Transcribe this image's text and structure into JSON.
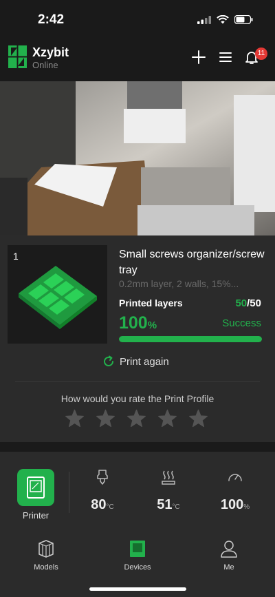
{
  "status_bar": {
    "time": "2:42"
  },
  "header": {
    "app_name": "Xzybit",
    "status": "Online",
    "notifications_count": "11",
    "icons": [
      "plus-icon",
      "menu-icon",
      "bell-icon"
    ]
  },
  "job": {
    "number": "1",
    "title": "Small screws organizer/screw tray",
    "description": "0.2mm layer, 2 walls, 15%...",
    "layers_label": "Printed layers",
    "layers_current": "50",
    "layers_total": "/50",
    "percent": "100",
    "percent_unit": "%",
    "progress_fraction": 1.0,
    "status": "Success",
    "print_again": "Print again"
  },
  "rating": {
    "title": "How would you rate the Print Profile",
    "stars": 5,
    "filled": 0
  },
  "dock": {
    "printer_label": "Printer",
    "stats": [
      {
        "icon": "nozzle-icon",
        "value": "80",
        "unit": "°C"
      },
      {
        "icon": "heatbed-icon",
        "value": "51",
        "unit": "°C"
      },
      {
        "icon": "speed-gauge-icon",
        "value": "100",
        "unit": "%"
      }
    ]
  },
  "tabs": [
    {
      "label": "Models",
      "icon": "models-icon",
      "active": false
    },
    {
      "label": "Devices",
      "icon": "devices-icon",
      "active": true
    },
    {
      "label": "Me",
      "icon": "me-icon",
      "active": false
    }
  ],
  "colors": {
    "accent": "#22b14c",
    "background": "#1a1a1a",
    "panel": "#2b2b2b",
    "badge": "#e53935"
  }
}
